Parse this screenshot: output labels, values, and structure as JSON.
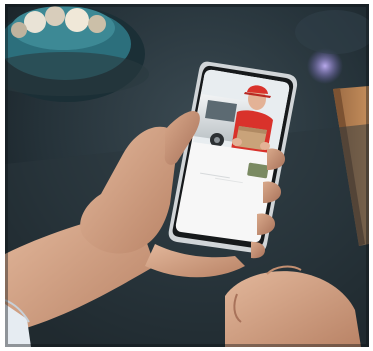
{
  "photo": {
    "scene": "hands-holding-smartphone",
    "phone_screen": {
      "card_title_line1": "",
      "card_title_line2": "",
      "card_meta": ""
    }
  },
  "colors": {
    "background": "#1f2a30",
    "cap_red": "#d9322b",
    "phone_frame": "#cfd3d6",
    "screen_white": "#f7f7f7",
    "parcel": "#c9a37a"
  }
}
